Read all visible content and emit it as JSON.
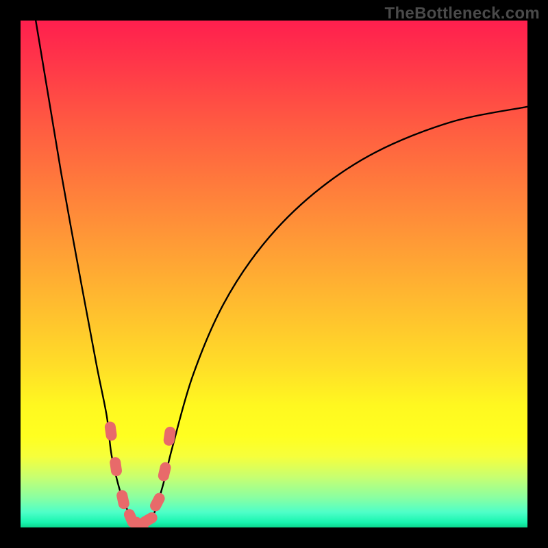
{
  "watermark": "TheBottleneck.com",
  "colors": {
    "frame": "#000000",
    "curve": "#000000",
    "markers": "#e86a6a",
    "gradient_top": "#ff1f4e",
    "gradient_bottom": "#0cd68e"
  },
  "chart_data": {
    "type": "line",
    "title": "",
    "xlabel": "",
    "ylabel": "",
    "xlim": [
      0,
      100
    ],
    "ylim": [
      0,
      100
    ],
    "grid": false,
    "legend": false,
    "series": [
      {
        "name": "bottleneck-curve",
        "x": [
          3,
          5,
          8,
          12,
          15,
          17,
          18,
          20,
          22,
          24,
          26,
          28,
          30,
          34,
          40,
          48,
          58,
          70,
          85,
          100
        ],
        "y": [
          100,
          88,
          70,
          48,
          32,
          22,
          14,
          6,
          2,
          0,
          2,
          8,
          16,
          30,
          44,
          56,
          66,
          74,
          80,
          83
        ]
      }
    ],
    "markers": {
      "name": "highlighted-points",
      "x": [
        17.8,
        18.8,
        20.2,
        21.8,
        23.5,
        25.2,
        27.0,
        28.4,
        29.4
      ],
      "y": [
        19,
        12,
        5.5,
        1.8,
        0.5,
        1.5,
        5,
        11,
        18
      ]
    }
  }
}
